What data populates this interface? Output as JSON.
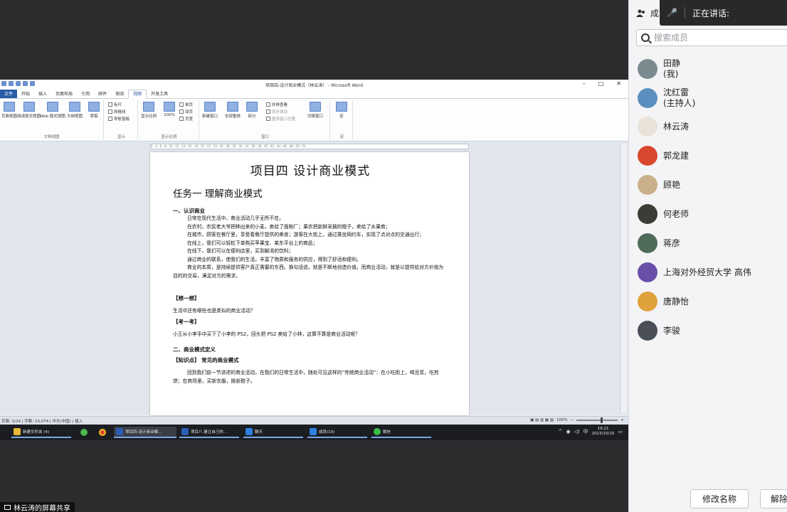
{
  "word": {
    "window_title": "项目四-设计商业模式（林云涛） - Microsoft Word",
    "window_controls": [
      "–",
      "□",
      "✕"
    ],
    "tabs": [
      "文件",
      "开始",
      "插入",
      "页面布局",
      "引用",
      "邮件",
      "审阅",
      "视图",
      "开发工具"
    ],
    "active_tab": "视图",
    "ribbon": {
      "views": [
        "页面视图",
        "阅读版式视图",
        "Web 版式视图",
        "大纲视图",
        "草稿"
      ],
      "views_group": "文档视图",
      "show": [
        "标尺",
        "网格线",
        "导航窗格"
      ],
      "show_group": "显示",
      "zoom": [
        "显示比例",
        "100%",
        "单页",
        "双页",
        "页宽"
      ],
      "zoom_group": "显示比例",
      "window": [
        "新建窗口",
        "全部重排",
        "拆分",
        "并排查看",
        "同步滚动",
        "重设窗口位置",
        "切换窗口"
      ],
      "window_group": "窗口",
      "macro": "宏",
      "macro_group": "宏"
    },
    "ruler_text": "2 · 4 · 6 · 8 · 10 · 12 · 14 · 16 · 18 · 20 · 22 · 24 · 26 · 28 · 30 · 32 · 34 · 36 · 38 · 40 · 42 · 44 · 46 · 48 · 50 · 52",
    "doc": {
      "title": "项目四  设计商业模式",
      "task": "任务一  理解商业模式",
      "s1": "一、认识商业",
      "p1": "日常在现代生活中，商业活动几乎无所不在。",
      "p2": "在农村，农民老大爷把种出来的小麦，卖给了面粉厂；果农把新鲜采摘的橙子，卖给了水果商；",
      "p3": "在城市，顾客在餐厅里，享受着餐厅提供的美食；游客在大街上，通过乘坐网约车，实现了点对点的交通出行；",
      "p4": "在线上，我们可以轻松下单购买苹果宝、某东平台上的商品；",
      "p5": "在线下，我们可以在便利店里，买到解渴的饮料；",
      "p6": "通过商业的联系，使我们的生活，丰富了物质和服务的供应，得到了舒适和便利。",
      "p7": "商业的本质，是持续提供客户真正需要的东西。换句话说，就是不断地创造价值。而商业活动，就是以提供给对方价值为目的的交易，满足对方的需求。",
      "think_label": "【想一想】",
      "think": "生活中还有哪些也是类似的商业活动？",
      "test_label": "【考一考】",
      "test": "小王从小李手中买下了小李的 PS2，回头把 PS2 卖给了小林，这算不算是商业活动呢？",
      "s2": "二、商业模式定义",
      "knowledge": "【知识点】 常见的商业模式",
      "p8": "回到我们前一节讲述的商业活动，在我们的日常生活中，随处可见这样的“传统商业活动”：在小吃街上，喝豆浆，吃煎饼；在商场里，买新衣服，换新鞋子。"
    },
    "status": "页面: 1/24  |  字数: 23,074  |  中文(中国)  |  插入",
    "zoom_level": "100%"
  },
  "taskbar": {
    "items": [
      "新建文件夹 (4)",
      "项目四-设计商业模...",
      "项目八 建立自己的...",
      "聊天",
      "成员(10)",
      "微信"
    ],
    "ime": "中",
    "time": "19:21",
    "date": "2023/10/10"
  },
  "share_label": "林云涛的屏幕共享",
  "panel": {
    "header": "成",
    "speaking": "正在讲话:",
    "search_placeholder": "搜索成员",
    "members": [
      {
        "name": "田静",
        "note": "(我)",
        "color": "#7b8a8f"
      },
      {
        "name": "沈红雷",
        "note": "(主持人)",
        "color": "#5a8fbf"
      },
      {
        "name": "林云涛",
        "note": "",
        "color": "#e8e2d8"
      },
      {
        "name": "郭龙建",
        "note": "",
        "color": "#d9472e"
      },
      {
        "name": "顾艳",
        "note": "",
        "color": "#c9b08a"
      },
      {
        "name": "何老师",
        "note": "",
        "color": "#3d3b35"
      },
      {
        "name": "蒋彦",
        "note": "",
        "color": "#4f6b5a"
      },
      {
        "name": "上海对外经贸大学 高伟",
        "note": "",
        "color": "#6a4fa8"
      },
      {
        "name": "唐静怡",
        "note": "",
        "color": "#e0a23c"
      },
      {
        "name": "李骏",
        "note": "",
        "color": "#4b5058"
      }
    ],
    "rename_button": "修改名称",
    "unmute_button": "解除"
  }
}
